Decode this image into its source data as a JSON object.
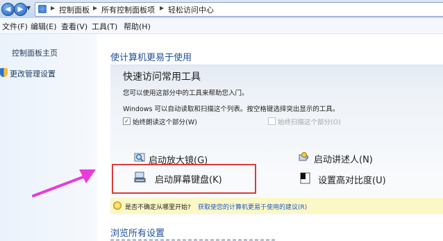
{
  "address_bar": {
    "crumbs": [
      "控制面板",
      "所有控制面板项",
      "轻松访问中心"
    ]
  },
  "menu": {
    "items": [
      "文件(F)",
      "编辑(E)",
      "查看(V)",
      "工具(T)",
      "帮助(H)"
    ]
  },
  "sidebar": {
    "items": [
      {
        "label": "控制面板主页",
        "icon": "none"
      },
      {
        "label": "更改管理设置",
        "icon": "shield-icon"
      }
    ]
  },
  "main": {
    "heading": "使计算机更易于使用",
    "quick_access": {
      "title": "快速访问常用工具",
      "line1": "您可以使用这部分中的工具来帮助您入门。",
      "line2": "Windows 可以自动读取和扫描这个列表。按空格键选择突出显示的工具。",
      "option_read": {
        "label": "始终朗读这个部分(W)",
        "checked": true
      },
      "option_scan": {
        "label": "始终扫描这个部分(O)",
        "checked": false,
        "enabled": false
      }
    },
    "tools": [
      {
        "label": "启动放大镜(G)",
        "icon": "magnifier-icon"
      },
      {
        "label": "启动讲述人(N)",
        "icon": "narrator-icon"
      },
      {
        "label": "启动屏幕键盘(K)",
        "icon": "keyboard-icon"
      },
      {
        "label": "设置高对比度(U)",
        "icon": "contrast-icon"
      }
    ],
    "hint": {
      "question": "是否不确定从哪里开始?",
      "link": "获取使您的计算机更易于使用的建议(R)"
    },
    "browse_heading": "浏览所有设置"
  },
  "colors": {
    "heading_blue": "#1d4f9c",
    "highlight_red": "#d93a3a",
    "arrow_magenta": "#e83bd8",
    "hint_background": "#fbf8c6"
  }
}
